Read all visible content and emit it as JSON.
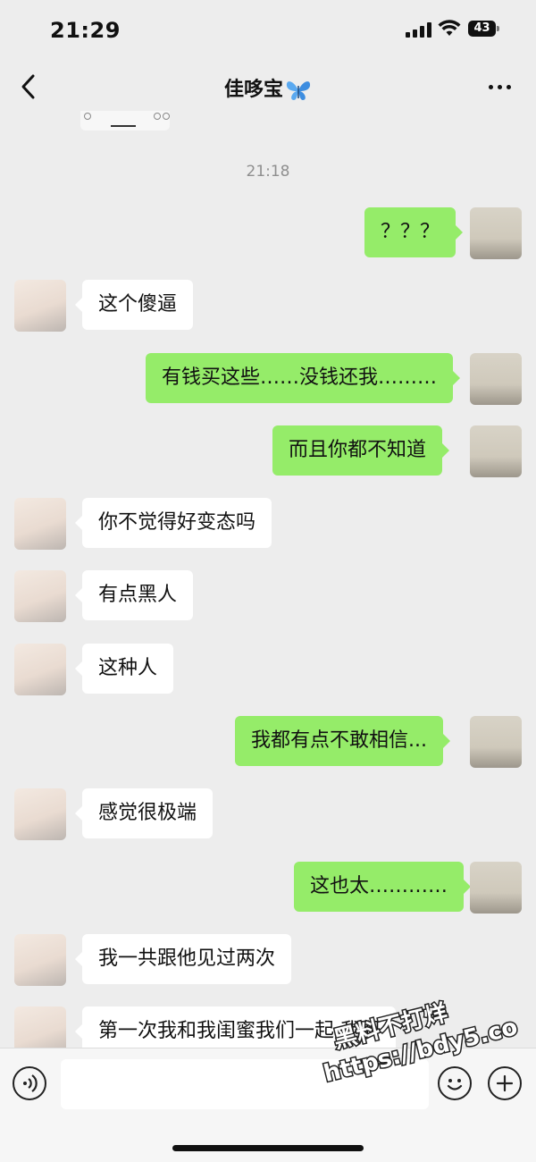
{
  "status_bar": {
    "time": "21:29",
    "battery": "43"
  },
  "header": {
    "title": "佳哆宝"
  },
  "timestamp": "21:18",
  "messages": [
    {
      "side": "out",
      "text": "？？？"
    },
    {
      "side": "in",
      "text": "这个傻逼"
    },
    {
      "side": "out",
      "text": "有钱买这些……没钱还我………"
    },
    {
      "side": "out",
      "text": "而且你都不知道"
    },
    {
      "side": "in",
      "text": "你不觉得好变态吗"
    },
    {
      "side": "in",
      "text": "有点黑人"
    },
    {
      "side": "in",
      "text": "这种人"
    },
    {
      "side": "out",
      "text": "我都有点不敢相信..."
    },
    {
      "side": "in",
      "text": "感觉很极端"
    },
    {
      "side": "out",
      "text": "这也太…………"
    },
    {
      "side": "in",
      "text": "我一共跟他见过两次"
    },
    {
      "side": "in",
      "text": "第一次我和我闺蜜我们一起 我们"
    }
  ],
  "input": {
    "placeholder": ""
  },
  "watermark": {
    "line1": "黑料不打烊",
    "line2": "https://bdy5.co"
  },
  "colors": {
    "outgoing_bubble": "#95ec69",
    "incoming_bubble": "#ffffff",
    "background": "#ededed"
  }
}
